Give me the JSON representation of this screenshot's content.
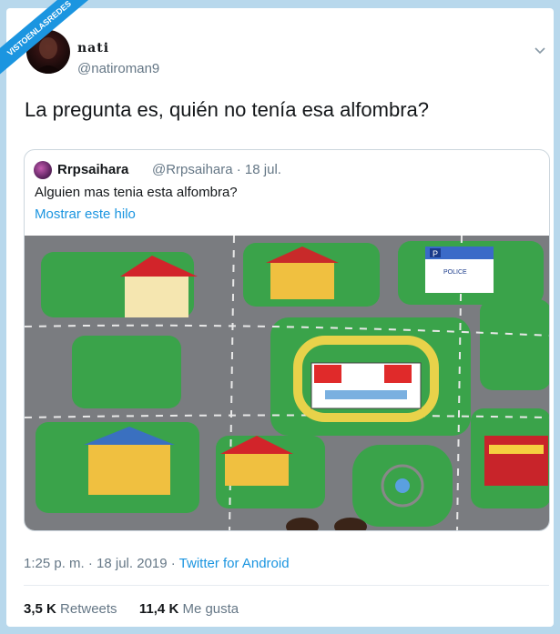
{
  "watermark": {
    "text": "VISTOENLASREDES",
    "color": "#1b95e0"
  },
  "tweet": {
    "display_name": "nati",
    "handle": "@natiroman9",
    "text": "La pregunta es, quién no tenía esa alfombra?",
    "timestamp": "1:25 p. m. · 18 jul. 2019 · ",
    "source": "Twitter for Android",
    "retweets_count": "3,5 K",
    "retweets_label": "Retweets",
    "likes_count": "11,4 K",
    "likes_label": "Me gusta",
    "icons": {
      "menu": "chevron-down-icon"
    }
  },
  "quoted": {
    "display_name": "Rrpsaihara",
    "meta": "@Rrpsaihara · 18 jul.",
    "text": "Alguien mas tenia esta alfombra?",
    "show_thread": "Mostrar este hilo",
    "image_labels": {
      "police": "POLICE",
      "parking": "P"
    }
  },
  "colors": {
    "link": "#1b95e0",
    "secondary": "#657786",
    "text": "#14171a",
    "border": "#ccd6dd"
  }
}
